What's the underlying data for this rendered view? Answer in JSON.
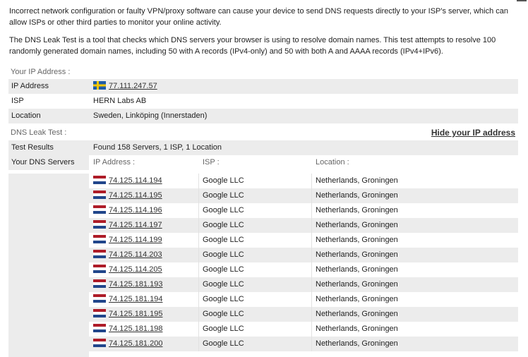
{
  "intro": {
    "p1": "Incorrect network configuration or faulty VPN/proxy software can cause your device to send DNS requests directly to your ISP's server, which can allow ISPs or other third parties to monitor your online activity.",
    "p2": "The DNS Leak Test is a tool that checks which DNS servers your browser is using to resolve domain names. This test attempts to resolve 100 randomly generated domain names, including 50 with A records (IPv4-only) and 50 with both A and AAAA records (IPv4+IPv6)."
  },
  "ip_section": {
    "title": "Your IP Address :",
    "rows": [
      {
        "label": "IP Address",
        "value": "77.111.247.57"
      },
      {
        "label": "ISP",
        "value": "HERN Labs AB"
      },
      {
        "label": "Location",
        "value": "Sweden, Linköping (Innerstaden)"
      }
    ]
  },
  "dns_section": {
    "title": "DNS Leak Test :",
    "hide_link": "Hide your IP address",
    "test_results_label": "Test Results",
    "test_results_value": "Found 158 Servers, 1 ISP, 1 Location",
    "servers_label": "Your DNS Servers",
    "headers": [
      "IP Address :",
      "ISP :",
      "Location :"
    ],
    "servers": [
      {
        "ip": "74.125.114.194",
        "isp": "Google LLC",
        "location": "Netherlands, Groningen"
      },
      {
        "ip": "74.125.114.195",
        "isp": "Google LLC",
        "location": "Netherlands, Groningen"
      },
      {
        "ip": "74.125.114.196",
        "isp": "Google LLC",
        "location": "Netherlands, Groningen"
      },
      {
        "ip": "74.125.114.197",
        "isp": "Google LLC",
        "location": "Netherlands, Groningen"
      },
      {
        "ip": "74.125.114.199",
        "isp": "Google LLC",
        "location": "Netherlands, Groningen"
      },
      {
        "ip": "74.125.114.203",
        "isp": "Google LLC",
        "location": "Netherlands, Groningen"
      },
      {
        "ip": "74.125.114.205",
        "isp": "Google LLC",
        "location": "Netherlands, Groningen"
      },
      {
        "ip": "74.125.181.193",
        "isp": "Google LLC",
        "location": "Netherlands, Groningen"
      },
      {
        "ip": "74.125.181.194",
        "isp": "Google LLC",
        "location": "Netherlands, Groningen"
      },
      {
        "ip": "74.125.181.195",
        "isp": "Google LLC",
        "location": "Netherlands, Groningen"
      },
      {
        "ip": "74.125.181.198",
        "isp": "Google LLC",
        "location": "Netherlands, Groningen"
      },
      {
        "ip": "74.125.181.200",
        "isp": "Google LLC",
        "location": "Netherlands, Groningen"
      }
    ]
  },
  "flags": {
    "ip": "sweden-flag-icon",
    "servers": "netherlands-flag-icon"
  },
  "colors": {
    "row_grey": "#ececec",
    "link": "#333333"
  }
}
